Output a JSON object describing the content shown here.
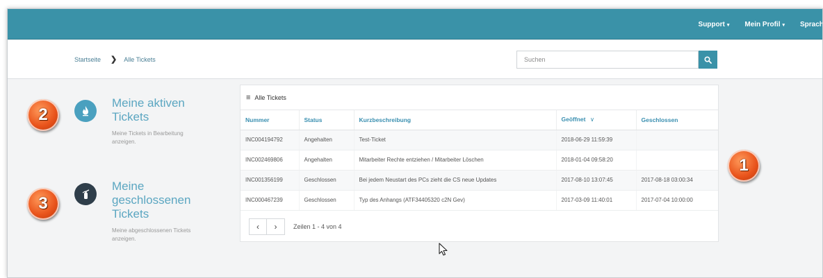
{
  "header": {
    "nav": [
      {
        "label": "Support",
        "caret": "▾"
      },
      {
        "label": "Mein Profil",
        "caret": "▾"
      },
      {
        "label": "Sprache",
        "caret": "▾"
      }
    ]
  },
  "breadcrumb": {
    "home": "Startseite",
    "separator": "❯",
    "current": "Alle Tickets"
  },
  "search": {
    "placeholder": "Suchen",
    "icon": "search-icon"
  },
  "side": {
    "active": {
      "title_line1": "Meine aktiven",
      "title_line2": "Tickets",
      "desc_line1": "Meine Tickets in Bearbeitung",
      "desc_line2": "anzeigen.",
      "icon": "flame-icon"
    },
    "closed": {
      "title_line1": "Meine",
      "title_line2": "geschlossenen",
      "title_line3": "Tickets",
      "desc_line1": "Meine abgeschlossenen Tickets",
      "desc_line2": "anzeigen.",
      "icon": "fire-extinguisher-icon"
    }
  },
  "badges": {
    "one": "1",
    "two": "2",
    "three": "3"
  },
  "panel": {
    "title": "Alle Tickets",
    "menu_icon": "≡",
    "columns": {
      "number": "Nummer",
      "status": "Status",
      "summary": "Kurzbeschreibung",
      "opened": "Geöffnet",
      "opened_sort": "∨",
      "closed": "Geschlossen"
    },
    "rows": [
      {
        "number": "INC004194792",
        "status": "Angehalten",
        "summary": "Test-Ticket",
        "opened": "2018-06-29 11:59:39",
        "closed": ""
      },
      {
        "number": "INC002469806",
        "status": "Angehalten",
        "summary": "Mitarbeiter Rechte entziehen / Mitarbeiter Löschen",
        "opened": "2018-01-04 09:58:20",
        "closed": ""
      },
      {
        "number": "INC001356199",
        "status": "Geschlossen",
        "summary": "Bei jedem Neustart des PCs zieht die CS neue Updates",
        "opened": "2017-08-10 13:07:45",
        "closed": "2017-08-18 03:00:34"
      },
      {
        "number": "INC000467239",
        "status": "Geschlossen",
        "summary": "Typ des Anhangs (ATF34405320 c2N Gev)",
        "opened": "2017-03-09 11:40:01",
        "closed": "2017-07-04 10:00:00"
      }
    ],
    "pager": {
      "prev": "‹",
      "next": "›",
      "text": "Zeilen 1 - 4 von 4"
    }
  },
  "colors": {
    "accent": "#3a92a8",
    "link": "#5ba6c1",
    "badge": "#e9541c"
  }
}
